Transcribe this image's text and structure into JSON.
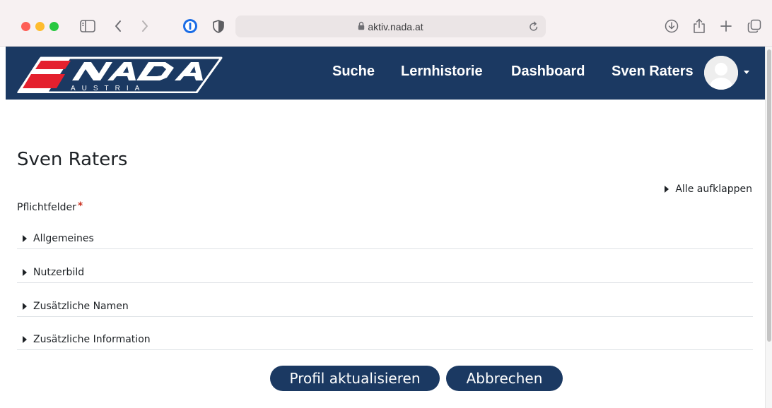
{
  "browser": {
    "url": "aktiv.nada.at"
  },
  "site": {
    "logo_text": "NADA",
    "logo_subtext": "AUSTRIA",
    "brand_color": "#1b3962",
    "nav": [
      {
        "label": "Suche"
      },
      {
        "label": "Lernhistorie"
      },
      {
        "label": "Dashboard"
      }
    ],
    "user_name": "Sven Raters"
  },
  "main": {
    "title": "Sven Raters",
    "expand_all": "Alle aufklappen",
    "required_label": "Pflichtfelder",
    "required_marker": "*",
    "sections": [
      {
        "label": "Allgemeines"
      },
      {
        "label": "Nutzerbild"
      },
      {
        "label": "Zusätzliche Namen"
      },
      {
        "label": "Zusätzliche Information"
      }
    ],
    "submit_label": "Profil aktualisieren",
    "cancel_label": "Abbrechen"
  },
  "icons": [
    "sidebar-icon",
    "back-icon",
    "forward-icon",
    "password-manager-icon",
    "shield-icon",
    "lock-icon",
    "reload-icon",
    "download-icon",
    "share-icon",
    "new-tab-icon",
    "tabs-overview-icon",
    "avatar-icon",
    "chevron-down-icon"
  ]
}
